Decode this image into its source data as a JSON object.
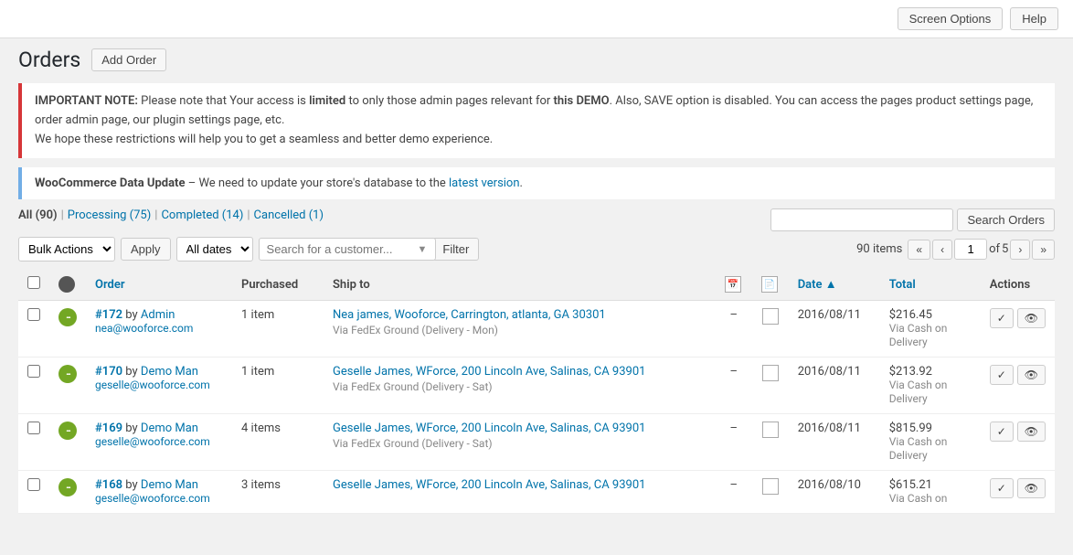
{
  "topbar": {
    "screen_options": "Screen Options",
    "help": "Help"
  },
  "header": {
    "title": "Orders",
    "add_order_label": "Add Order"
  },
  "notices": {
    "error": {
      "text1": "IMPORTANT NOTE: Please note that Your access is ",
      "limited": "limited",
      "text2": " to only those admin pages relevant for ",
      "this_demo": "this DEMO",
      "text3": ". Also, SAVE option is disabled. You can access the pages product settings page, order admin page, our plugin settings page, etc.",
      "text4": "We hope these restrictions will help you to get a seamless and better demo experience."
    },
    "info": {
      "bold": "WooCommerce Data Update",
      "text": " – We need to update your store's database to the ",
      "link_text": "latest version",
      "period": "."
    }
  },
  "filters": {
    "tabs": [
      {
        "label": "All",
        "count": "90",
        "href": "#",
        "current": true
      },
      {
        "label": "Processing",
        "count": "75",
        "href": "#",
        "current": false
      },
      {
        "label": "Completed",
        "count": "14",
        "href": "#",
        "current": false
      },
      {
        "label": "Cancelled",
        "count": "1",
        "href": "#",
        "current": false
      }
    ],
    "bulk_actions_label": "Bulk Actions",
    "apply_label": "Apply",
    "all_dates_label": "All dates",
    "customer_placeholder": "Search for a customer...",
    "filter_label": "Filter",
    "items_count": "90 items",
    "pagination": {
      "prev_prev": "«",
      "prev": "‹",
      "current_page": "1",
      "of": "of",
      "total_pages": "5",
      "next": "›",
      "next_next": "»"
    },
    "search_input_placeholder": "",
    "search_orders_label": "Search Orders"
  },
  "table": {
    "columns": [
      {
        "id": "cb",
        "label": ""
      },
      {
        "id": "status",
        "label": ""
      },
      {
        "id": "order",
        "label": "Order"
      },
      {
        "id": "purchased",
        "label": "Purchased"
      },
      {
        "id": "ship_to",
        "label": "Ship to"
      },
      {
        "id": "calendar_icon",
        "label": ""
      },
      {
        "id": "page_icon",
        "label": ""
      },
      {
        "id": "date",
        "label": "Date ▲"
      },
      {
        "id": "total",
        "label": "Total"
      },
      {
        "id": "actions",
        "label": "Actions"
      }
    ],
    "rows": [
      {
        "id": "row1",
        "checked": false,
        "status_color": "#73a724",
        "order_number": "#172",
        "by_text": "by",
        "author": "Admin",
        "email": "nea@wooforce.com",
        "purchased": "1 item",
        "ship_name": "Nea james, Wooforce, Carrington, atlanta, GA 30301",
        "ship_via": "Via FedEx Ground (Delivery - Mon)",
        "dash": "–",
        "date": "2016/08/11",
        "total": "$216.45",
        "payment": "Via Cash on Delivery"
      },
      {
        "id": "row2",
        "checked": false,
        "status_color": "#73a724",
        "order_number": "#170",
        "by_text": "by",
        "author": "Demo Man",
        "email": "geselle@wooforce.com",
        "purchased": "1 item",
        "ship_name": "Geselle James, WForce, 200 Lincoln Ave, Salinas, CA 93901",
        "ship_via": "Via FedEx Ground (Delivery - Sat)",
        "dash": "–",
        "date": "2016/08/11",
        "total": "$213.92",
        "payment": "Via Cash on Delivery"
      },
      {
        "id": "row3",
        "checked": false,
        "status_color": "#73a724",
        "order_number": "#169",
        "by_text": "by",
        "author": "Demo Man",
        "email": "geselle@wooforce.com",
        "purchased": "4 items",
        "ship_name": "Geselle James, WForce, 200 Lincoln Ave, Salinas, CA 93901",
        "ship_via": "Via FedEx Ground (Delivery - Sat)",
        "dash": "–",
        "date": "2016/08/11",
        "total": "$815.99",
        "payment": "Via Cash on Delivery"
      },
      {
        "id": "row4",
        "checked": false,
        "status_color": "#73a724",
        "order_number": "#168",
        "by_text": "by",
        "author": "Demo Man",
        "email": "geselle@wooforce.com",
        "purchased": "3 items",
        "ship_name": "Geselle James, WForce, 200 Lincoln Ave, Salinas, CA 93901",
        "ship_via": "",
        "dash": "–",
        "date": "2016/08/10",
        "total": "$615.21",
        "payment": "Via Cash on"
      }
    ]
  }
}
